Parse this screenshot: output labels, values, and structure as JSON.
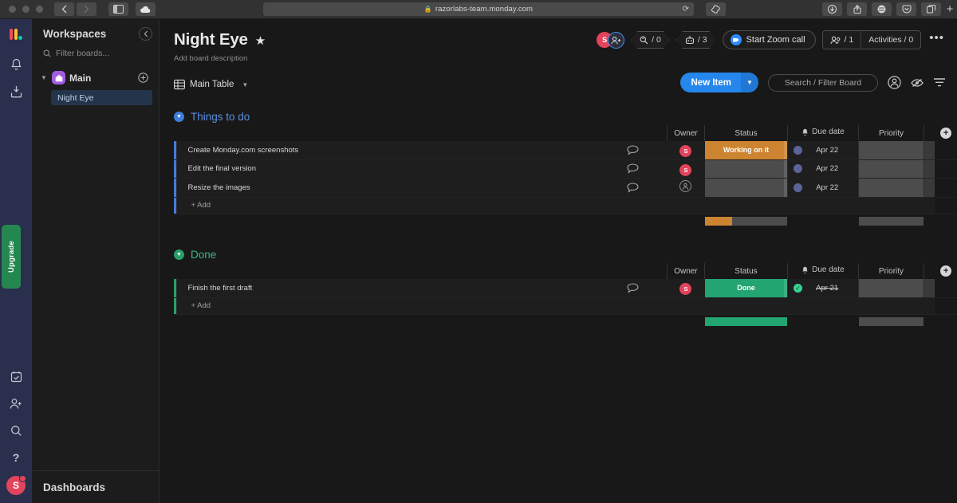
{
  "browser": {
    "url": "razorlabs-team.monday.com",
    "lock_icon": "lock-icon",
    "back_icon": "chevron-left-icon",
    "forward_icon": "chevron-right-icon",
    "sidebar_toggle_icon": "sidebar-toggle-icon",
    "cloud_icon": "icloud-icon",
    "shield_icon": "shield-icon",
    "reload_icon": "reload-icon",
    "extension_icon": "extension-icon",
    "right_icons": [
      "download-icon",
      "share-icon",
      "globe-icon",
      "pocket-icon",
      "tabs-icon"
    ],
    "new_tab_label": "+"
  },
  "rail": {
    "logo_icon": "monday-logo-icon",
    "notifications_icon": "bell-icon",
    "inbox_icon": "inbox-icon",
    "upgrade_label": "Upgrade",
    "bottom_icons": [
      "calendar-check-icon",
      "invite-member-icon",
      "search-icon",
      "help-icon"
    ],
    "avatar_initial": "S"
  },
  "sidebar": {
    "title": "Workspaces",
    "collapse_icon": "chevron-left-icon",
    "filter_placeholder": "Filter boards...",
    "filter_icon": "search-icon",
    "workspace": {
      "name": "Main",
      "icon": "home-icon",
      "add_label": "+",
      "caret_icon": "chevron-down-icon"
    },
    "boards": [
      {
        "label": "Night Eye",
        "selected": true
      }
    ],
    "footer_label": "Dashboards"
  },
  "header": {
    "board_title": "Night Eye",
    "star_icon": "star-filled-icon",
    "description_placeholder": "Add board description",
    "avatar_initial": "S",
    "add_person_icon": "add-person-icon",
    "integrations": {
      "icon": "integrations-icon",
      "label": "/ 0"
    },
    "automations": {
      "icon": "robot-icon",
      "label": "/ 3"
    },
    "zoom_call": {
      "label": "Start Zoom call",
      "icon": "zoom-camera-icon"
    },
    "members": {
      "icon": "people-icon",
      "label": "/ 1"
    },
    "activities": {
      "label": "Activities / 0"
    },
    "more_menu_label": "•••"
  },
  "toolbar": {
    "view_label": "Main Table",
    "view_icon": "table-icon",
    "view_chevron_icon": "chevron-down-icon",
    "new_item_label": "New Item",
    "new_item_arrow_icon": "chevron-down-icon",
    "search_placeholder": "Search / Filter Board",
    "person_icon": "person-circle-icon",
    "hide_icon": "eye-hide-icon",
    "filter_icon": "filter-icon"
  },
  "columns": {
    "chat": "",
    "owner": "Owner",
    "status": "Status",
    "due_date": "Due date",
    "due_date_icon": "bell-icon",
    "priority": "Priority",
    "add_column_label": "+"
  },
  "add_item_label": "+ Add",
  "groups": [
    {
      "name": "Things to do",
      "color": "#3f7ddc",
      "collapse_icon": "chevron-down-icon",
      "items": [
        {
          "name": "Create Monday.com screenshots",
          "chat_icon": "chat-bubble-icon",
          "owner": "S",
          "owner_assigned": true,
          "status": "Working on it",
          "status_color": "#cd8430",
          "due_date": "Apr 22",
          "due_done": false,
          "priority": ""
        },
        {
          "name": "Edit the final version",
          "chat_icon": "chat-bubble-icon",
          "owner": "S",
          "owner_assigned": true,
          "status": "",
          "status_color": "#4c4c4c",
          "due_date": "Apr 22",
          "due_done": false,
          "priority": ""
        },
        {
          "name": "Resize the images",
          "chat_icon": "chat-bubble-icon",
          "owner": "",
          "owner_assigned": false,
          "status": "",
          "status_color": "#4c4c4c",
          "due_date": "Apr 22",
          "due_done": false,
          "priority": ""
        }
      ],
      "summary": {
        "status_done_pct": 33,
        "priority_pct": 100
      }
    },
    {
      "name": "Done",
      "color": "#28a06a",
      "collapse_icon": "chevron-down-icon",
      "items": [
        {
          "name": "Finish the first draft",
          "chat_icon": "chat-bubble-icon",
          "owner": "S",
          "owner_assigned": true,
          "status": "Done",
          "status_color": "#22a571",
          "due_date": "Apr 21",
          "due_done": true,
          "priority": ""
        }
      ],
      "summary": {
        "status_done_pct": 100,
        "priority_pct": 100
      }
    }
  ],
  "colors": {
    "accent_blue": "#2586ec",
    "group_todo": "#3f7ddc",
    "group_done": "#28a06a",
    "status_working": "#cd8430",
    "status_done": "#22a571",
    "avatar_red": "#e2445c",
    "upgrade_green": "#258750",
    "rail_bg": "#292f4c"
  }
}
